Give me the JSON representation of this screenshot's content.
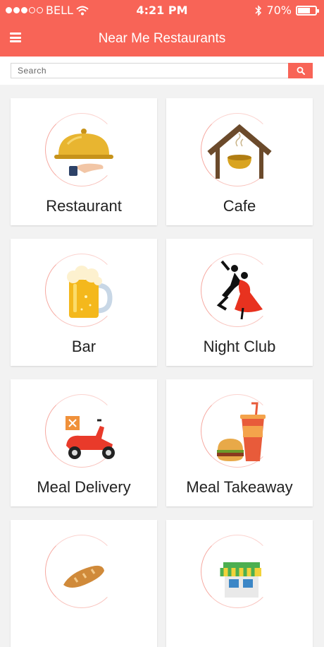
{
  "status_bar": {
    "carrier": "BELL",
    "time": "4:21 PM",
    "battery": "70%",
    "battery_level": 0.7
  },
  "header": {
    "title": "Near Me Restaurants",
    "menu_icon": "hamburger-menu-icon"
  },
  "search": {
    "placeholder": "Search",
    "button_icon": "search-icon"
  },
  "categories": [
    {
      "label": "Restaurant",
      "icon": "serving-cloche-icon"
    },
    {
      "label": "Cafe",
      "icon": "cafe-house-icon"
    },
    {
      "label": "Bar",
      "icon": "beer-mug-icon"
    },
    {
      "label": "Night Club",
      "icon": "dancing-couple-icon"
    },
    {
      "label": "Meal Delivery",
      "icon": "delivery-scooter-icon"
    },
    {
      "label": "Meal Takeaway",
      "icon": "takeaway-drink-burger-icon"
    },
    {
      "label": "",
      "icon": "bread-icon"
    },
    {
      "label": "",
      "icon": "store-awning-icon"
    }
  ],
  "colors": {
    "accent": "#f86457",
    "background": "#f2f2f2"
  }
}
